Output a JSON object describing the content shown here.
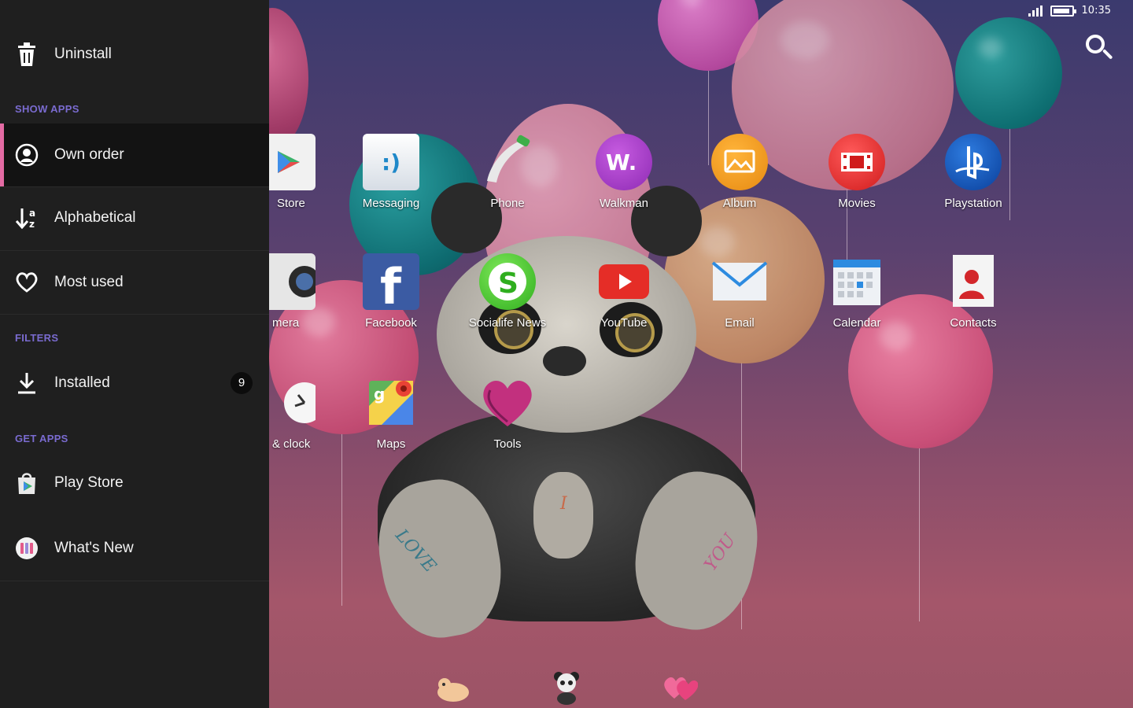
{
  "status_bar": {
    "time": "10:35"
  },
  "drawer": {
    "uninstall": "Uninstall",
    "sections": {
      "show_apps": "SHOW APPS",
      "filters": "FILTERS",
      "get_apps": "GET APPS"
    },
    "items": {
      "own_order": "Own order",
      "alphabetical": "Alphabetical",
      "most_used": "Most used",
      "installed": "Installed",
      "installed_count": "9",
      "play_store": "Play Store",
      "whats_new": "What's New"
    },
    "colors": {
      "accent": "#e46ba4",
      "section": "#7a6bd0",
      "background": "#1f1f1f"
    }
  },
  "apps": [
    {
      "label": "Store",
      "icon": "store-icon"
    },
    {
      "label": "Messaging",
      "icon": "messaging-icon"
    },
    {
      "label": "Phone",
      "icon": "phone-icon"
    },
    {
      "label": "Walkman",
      "icon": "walkman-icon"
    },
    {
      "label": "Album",
      "icon": "album-icon"
    },
    {
      "label": "Movies",
      "icon": "movies-icon"
    },
    {
      "label": "Playstation",
      "icon": "playstation-icon"
    },
    {
      "label": "mera",
      "icon": "camera-icon"
    },
    {
      "label": "Facebook",
      "icon": "facebook-icon"
    },
    {
      "label": "Socialife News",
      "icon": "socialife-icon"
    },
    {
      "label": "YouTube",
      "icon": "youtube-icon"
    },
    {
      "label": "Email",
      "icon": "email-icon"
    },
    {
      "label": "Calendar",
      "icon": "calendar-icon"
    },
    {
      "label": "Contacts",
      "icon": "contacts-icon"
    },
    {
      "label": "& clock",
      "icon": "clock-icon"
    },
    {
      "label": "Maps",
      "icon": "maps-icon"
    },
    {
      "label": "Tools",
      "icon": "tools-heart-icon"
    }
  ],
  "wallpaper_text": {
    "love": "LOVE",
    "i": "I",
    "you": "YOU"
  },
  "dock": [
    "cat-icon",
    "panda-icon",
    "hearts-icon"
  ]
}
